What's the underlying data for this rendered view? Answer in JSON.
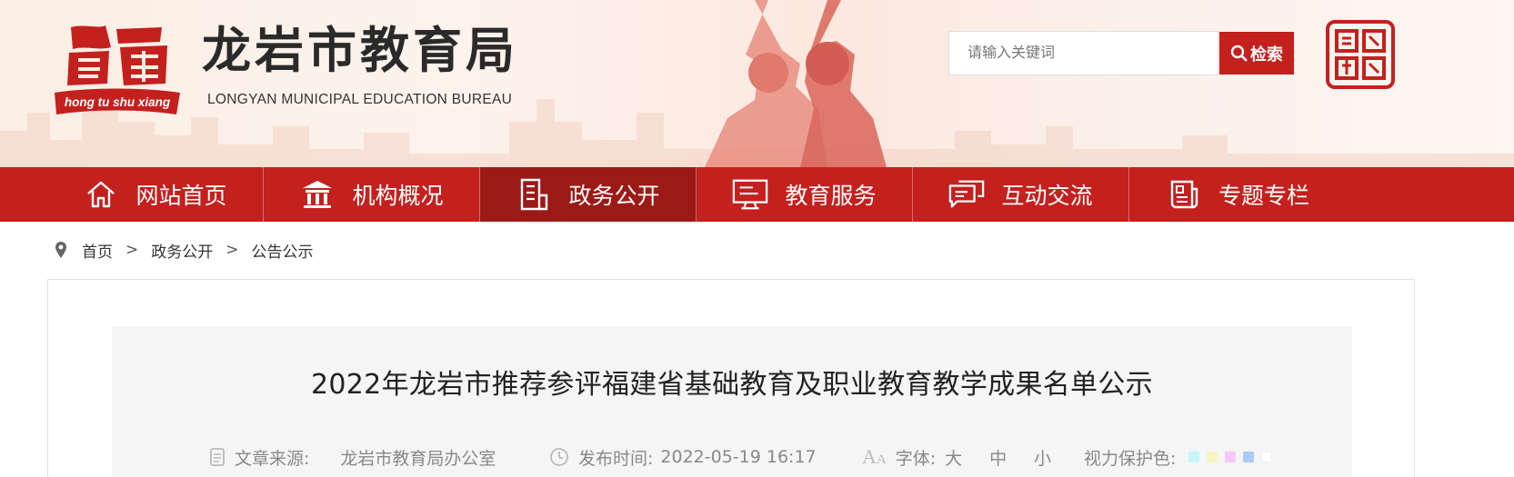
{
  "header": {
    "site_title": "龙岩市教育局",
    "site_subtitle": "LONGYAN MUNICIPAL EDUCATION BUREAU",
    "brand_tag": "hong tu shu xiang",
    "search_placeholder": "请输入关键词",
    "search_button": "检索"
  },
  "nav": {
    "items": [
      {
        "label": "网站首页",
        "icon": "home-icon"
      },
      {
        "label": "机构概况",
        "icon": "building-icon"
      },
      {
        "label": "政务公开",
        "icon": "document-icon",
        "active": true
      },
      {
        "label": "教育服务",
        "icon": "monitor-icon"
      },
      {
        "label": "互动交流",
        "icon": "chat-icon"
      },
      {
        "label": "专题专栏",
        "icon": "newspaper-icon"
      }
    ]
  },
  "breadcrumb": {
    "items": [
      "首页",
      "政务公开",
      "公告公示"
    ],
    "separator": ">"
  },
  "article": {
    "title": "2022年龙岩市推荐参评福建省基础教育及职业教育教学成果名单公示",
    "source_label": "文章来源:",
    "source_value": "龙岩市教育局办公室",
    "time_label": "发布时间:",
    "time_value": "2022-05-19 16:17",
    "font_label": "字体:",
    "font_sizes": [
      "大",
      "中",
      "小"
    ],
    "eye_label": "视力保护色:",
    "eye_colors": [
      "#c9f5f9",
      "#f5f5c4",
      "#f7c8f7",
      "#a8ccf5",
      "#ffffff"
    ]
  },
  "colors": {
    "brand_red": "#c4201e",
    "nav_active": "#9c1a16"
  }
}
